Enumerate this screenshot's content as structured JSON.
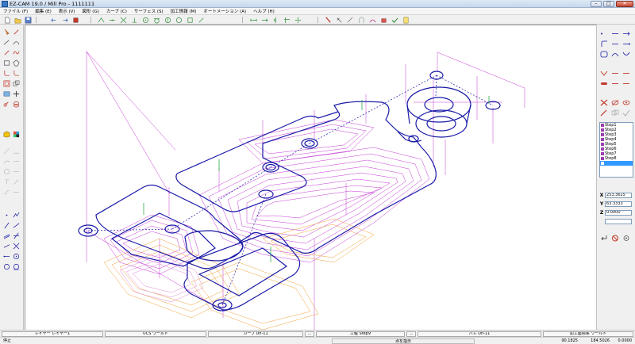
{
  "window": {
    "title": "EZ-CAM 19.0 / Mill Pro  -  1111111",
    "minimize": "–",
    "maximize": "□",
    "close": "✕"
  },
  "menu": [
    {
      "label": "ファイル (F)"
    },
    {
      "label": "編集 (E)"
    },
    {
      "label": "表示 (V)"
    },
    {
      "label": "図形 (G)"
    },
    {
      "label": "カーブ (C)"
    },
    {
      "label": "サーフェス (S)"
    },
    {
      "label": "加工情報 (M)"
    },
    {
      "label": "オートメーション (A)"
    },
    {
      "label": "ヘルプ (H)"
    }
  ],
  "toolbar": {
    "groups": [
      "file",
      "edit",
      "view-shapes",
      "snap",
      "tools"
    ]
  },
  "steps": {
    "items": [
      {
        "label": "Step1"
      },
      {
        "label": "Step2"
      },
      {
        "label": "Step3"
      },
      {
        "label": "Step4"
      },
      {
        "label": "Step5"
      },
      {
        "label": "Step6"
      },
      {
        "label": "Step7"
      },
      {
        "label": "Step8"
      },
      {
        "label": "Step9"
      }
    ],
    "selected_index": 8
  },
  "coordinates": {
    "x_label": "X",
    "x_value": "253.3615",
    "y_label": "Y",
    "y_value": "63.3333",
    "z_label": "Z",
    "z_value": "0.0000"
  },
  "infobar": {
    "layer": "レイヤー レイヤー1",
    "ucs": "UCS ワールド",
    "curve": "カーブ Un-11",
    "blank1": "...",
    "step": "工程 Step9",
    "blank2": "...",
    "pal": "パレ Un-11",
    "coord_sys": "加工座標系 ワールド"
  },
  "statusbar": {
    "state": "停止",
    "prompt": "点を指示",
    "x": "90.1825",
    "y": "184.5026",
    "z": "0.0000"
  },
  "colors": {
    "geometry": "#1a1aa8",
    "toolpath_magenta": "#c43bd4",
    "toolpath_orange": "#f0a23a",
    "toolpath_pink": "#e08ad8",
    "axis_green": "#2fa84a",
    "selected": "#3399ff"
  }
}
